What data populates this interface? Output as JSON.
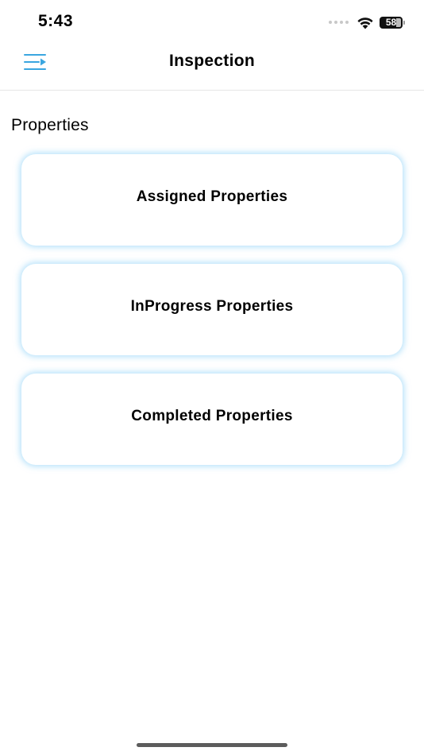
{
  "status_bar": {
    "time": "5:43",
    "battery_level": "58"
  },
  "nav": {
    "title": "Inspection",
    "menu_icon": "menu-arrow-icon",
    "accent_color": "#3aa6e0"
  },
  "section": {
    "title": "Properties"
  },
  "cards": [
    {
      "label": "Assigned Properties"
    },
    {
      "label": "InProgress Properties"
    },
    {
      "label": "Completed Properties"
    }
  ],
  "colors": {
    "card_glow": "#78c8f5",
    "background": "#ffffff"
  }
}
